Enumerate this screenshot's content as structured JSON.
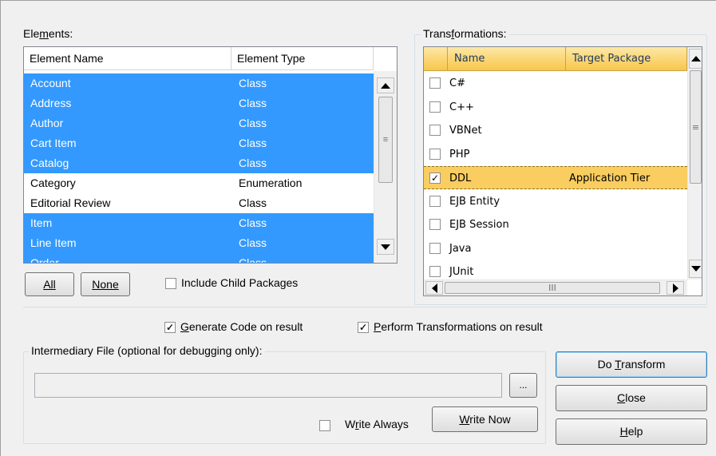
{
  "elements": {
    "label_pre": "Ele",
    "label_mn": "m",
    "label_post": "ents:",
    "columns": [
      "Element Name",
      "Element Type"
    ],
    "rows": [
      {
        "name": "Account",
        "type": "Class",
        "selected": true
      },
      {
        "name": "Address",
        "type": "Class",
        "selected": true
      },
      {
        "name": "Author",
        "type": "Class",
        "selected": true
      },
      {
        "name": "Cart Item",
        "type": "Class",
        "selected": true
      },
      {
        "name": "Catalog",
        "type": "Class",
        "selected": true
      },
      {
        "name": "Category",
        "type": "Enumeration",
        "selected": false
      },
      {
        "name": "Editorial Review",
        "type": "Class",
        "selected": false
      },
      {
        "name": "Item",
        "type": "Class",
        "selected": true
      },
      {
        "name": "Line Item",
        "type": "Class",
        "selected": true
      },
      {
        "name": "Order",
        "type": "Class",
        "selected": true
      }
    ],
    "all_button": "All",
    "none_button": "None",
    "include_child_label": "Include Child Packages",
    "include_child_checked": false
  },
  "transformations": {
    "label_pre": "Trans",
    "label_mn": "f",
    "label_post": "ormations:",
    "columns": [
      "Name",
      "Target Package"
    ],
    "rows": [
      {
        "name": "C#",
        "target": "",
        "checked": false,
        "highlighted": false
      },
      {
        "name": "C++",
        "target": "",
        "checked": false,
        "highlighted": false
      },
      {
        "name": "VBNet",
        "target": "",
        "checked": false,
        "highlighted": false
      },
      {
        "name": "PHP",
        "target": "",
        "checked": false,
        "highlighted": false
      },
      {
        "name": "DDL",
        "target": "Application Tier",
        "checked": true,
        "highlighted": true
      },
      {
        "name": "EJB Entity",
        "target": "",
        "checked": false,
        "highlighted": false
      },
      {
        "name": "EJB Session",
        "target": "",
        "checked": false,
        "highlighted": false
      },
      {
        "name": "Java",
        "target": "",
        "checked": false,
        "highlighted": false
      },
      {
        "name": "JUnit",
        "target": "",
        "checked": false,
        "highlighted": false
      }
    ],
    "hscroll_grip": "III",
    "vscroll_grip": "≡"
  },
  "options": {
    "generate_code_pre": "",
    "generate_code_mn": "G",
    "generate_code_post": "enerate Code on result",
    "generate_code_checked": true,
    "perform_pre": "",
    "perform_mn": "P",
    "perform_post": "erform Transformations on result",
    "perform_checked": true
  },
  "intermediary": {
    "title": "Intermediary File (optional for debugging only):",
    "path_value": "",
    "browse_label": "...",
    "write_always_pre": "W",
    "write_always_mn": "r",
    "write_always_post": "ite Always",
    "write_always_checked": false,
    "write_now_pre": "",
    "write_now_mn": "W",
    "write_now_post": "rite Now"
  },
  "actions": {
    "do_transform_pre": "Do ",
    "do_transform_mn": "T",
    "do_transform_post": "ransform",
    "close_pre": "",
    "close_mn": "C",
    "close_post": "lose",
    "help_pre": "",
    "help_mn": "H",
    "help_post": "elp"
  }
}
